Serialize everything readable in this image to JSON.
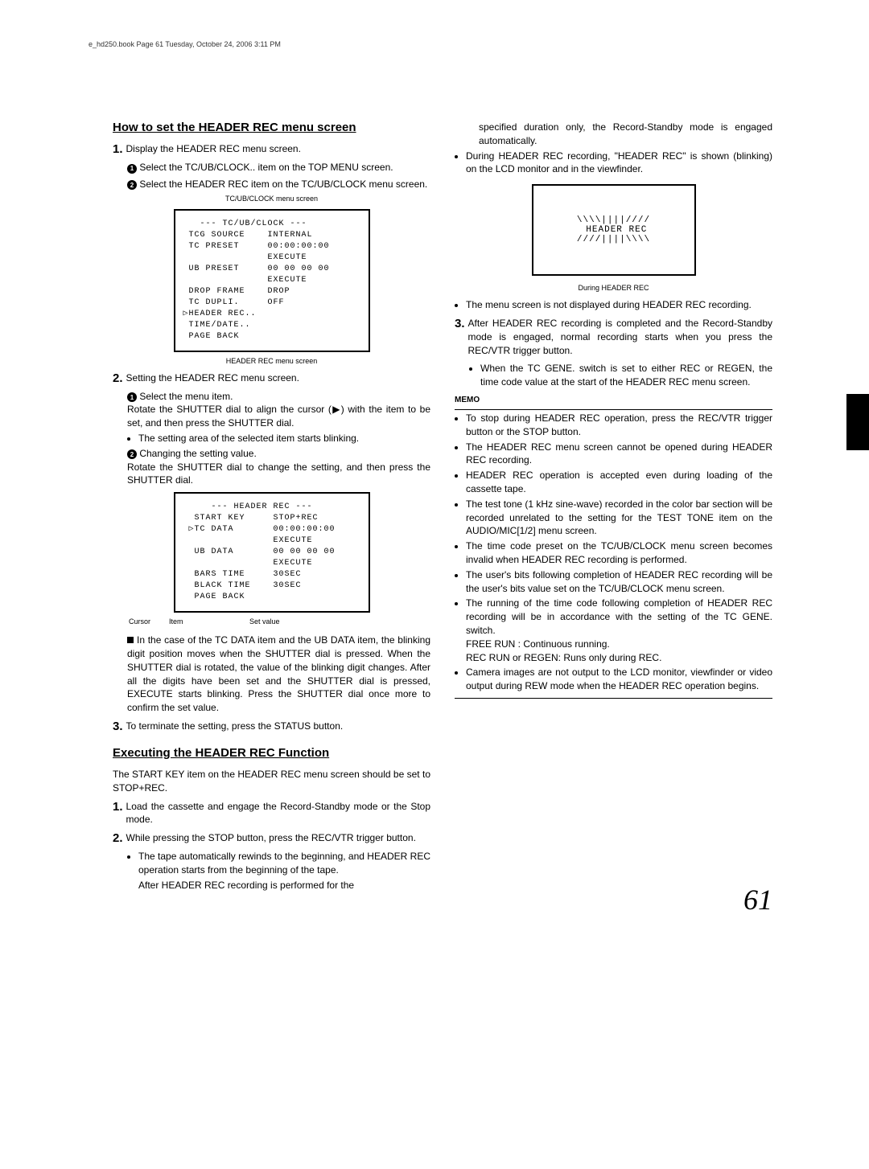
{
  "meta": {
    "header_line": "e_hd250.book  Page 61  Tuesday, October 24, 2006  3:11 PM",
    "page_num": "61"
  },
  "left": {
    "h1": "How to set the HEADER REC menu screen",
    "s1": {
      "num": "1.",
      "text": "Display the HEADER REC menu screen.",
      "a": "Select the TC/UB/CLOCK.. item on the TOP MENU screen.",
      "b": "Select the HEADER REC item on the TC/UB/CLOCK menu screen."
    },
    "cap1": "TC/UB/CLOCK menu screen",
    "screen1": "   --- TC/UB/CLOCK ---\n TCG SOURCE    INTERNAL\n TC PRESET     00:00:00:00\n               EXECUTE\n UB PRESET     00 00 00 00\n               EXECUTE\n DROP FRAME    DROP\n TC DUPLI.     OFF\n▷HEADER REC..\n TIME/DATE..\n PAGE BACK",
    "cap2": "HEADER REC menu screen",
    "s2": {
      "num": "2.",
      "text": "Setting the HEADER REC menu screen.",
      "a_title": "Select the menu item.",
      "a_body": "Rotate the SHUTTER dial to align the cursor (▶) with the item to be set, and then press the SHUTTER dial.",
      "a_bullet": "The setting area of the selected item starts blinking.",
      "b_title": "Changing the setting value.",
      "b_body": "Rotate the SHUTTER dial to change the setting, and then press the SHUTTER dial."
    },
    "screen2": "     --- HEADER REC ---\n  START KEY     STOP+REC\n ▷TC DATA       00:00:00:00\n                EXECUTE\n  UB DATA       00 00 00 00\n                EXECUTE\n  BARS TIME     30SEC\n  BLACK TIME    30SEC\n  PAGE BACK",
    "lbl": {
      "cursor": "Cursor",
      "item": "Item",
      "set": "Set value"
    },
    "note": "In the case of the TC DATA item and the UB DATA item, the blinking digit position moves when the SHUTTER dial is pressed. When the SHUTTER dial is rotated, the value of the blinking digit changes. After all the digits have been set and the SHUTTER dial is pressed, EXECUTE starts blinking. Press the SHUTTER dial once more to confirm the set value.",
    "s3": {
      "num": "3.",
      "text": "To terminate the setting, press the STATUS button."
    },
    "h2": "Executing the HEADER REC Function",
    "intro": "The START KEY item on the HEADER REC menu screen should be set to STOP+REC.",
    "e1": {
      "num": "1.",
      "text": "Load the cassette and engage the Record-Standby mode or the Stop mode."
    },
    "e2": {
      "num": "2.",
      "text": "While pressing the STOP button, press the REC/VTR trigger button.",
      "b1": "The tape automatically rewinds to the beginning, and HEADER REC operation starts from the beginning of the tape.",
      "b2": "After HEADER REC recording is performed for the"
    }
  },
  "right": {
    "cont1": "specified duration only, the Record-Standby mode is engaged automatically.",
    "cont2": "During HEADER REC recording, \"HEADER REC\" is shown (blinking) on the LCD monitor and in the viewfinder.",
    "vf": "\\\\\\\\||||////\n HEADER REC\n////||||\\\\\\\\",
    "capvf": "During HEADER REC",
    "note1": "The menu screen is not displayed during HEADER REC recording.",
    "s3": {
      "num": "3.",
      "text": "After HEADER REC recording is completed and the Record-Standby mode is engaged, normal recording starts when you press the REC/VTR trigger button.",
      "b": "When the TC GENE. switch is set to either REC or REGEN, the time code value at the start of the HEADER REC menu screen."
    },
    "memo_title": "MEMO",
    "memo": [
      "To stop during HEADER REC operation, press the REC/VTR trigger button or the STOP button.",
      "The HEADER REC menu screen cannot be opened during HEADER REC recording.",
      "HEADER REC operation is accepted even during loading of the cassette tape.",
      "The test tone (1 kHz sine-wave) recorded in the color bar section will be recorded unrelated to the setting for the TEST TONE item on the AUDIO/MIC[1/2] menu screen.",
      "The time code preset on the TC/UB/CLOCK menu screen becomes invalid when HEADER REC recording is performed.",
      "The user's bits following completion of HEADER REC recording will be the user's bits value set on the TC/UB/CLOCK menu screen.",
      "The running of the time code following completion of HEADER REC recording will be in accordance with the setting of the TC GENE. switch.\nFREE RUN               : Continuous running.\nREC RUN or REGEN: Runs only during REC.",
      "Camera images are not output to the LCD monitor, viewfinder or video output during REW mode when the HEADER REC operation begins."
    ]
  }
}
